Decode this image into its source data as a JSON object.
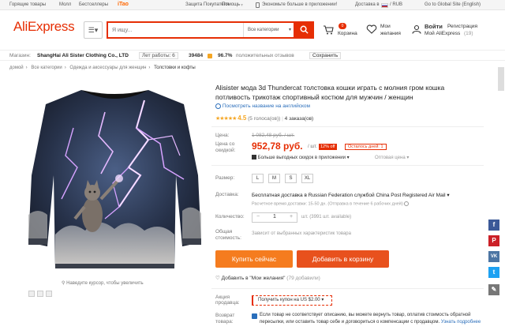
{
  "topbar": {
    "links": [
      "Горящие товары",
      "Молл",
      "Бестселлеры"
    ],
    "itao": "iTao",
    "buyer_protection": "Защита Покупателя",
    "help": "Помощь",
    "app_promo": "Экономьте больше в приложении!",
    "ship_to": "Доставка в",
    "currency": "/ RUB",
    "global_site": "Go to Global Site (English)"
  },
  "header": {
    "logo": "AliExpress",
    "search_placeholder": "Я ищу...",
    "search_category": "Все категории",
    "cart_count": "0",
    "cart_label": "Корзина",
    "wishlist_label_1": "Мои",
    "wishlist_label_2": "желания",
    "signin": "Войти",
    "register": "Регистрация",
    "my_ali": "Мой AliExpress",
    "my_ali_count": "(19)"
  },
  "store": {
    "label": "Магазин:",
    "name": "ShangHai Ali Sister Clothing Co., LTD",
    "years": "Лет работы: 6",
    "score": "39484",
    "positive": "96.7%",
    "positive_label": "положительных отзывов",
    "save": "Сохранить"
  },
  "breadcrumb": [
    "домой",
    "Все категории",
    "Одежда и аксессуары для женщин",
    "Толстовки и кофты"
  ],
  "product": {
    "title": "Alisister мода 3d Thundercat толстовка кошки играть с молния гром кошка потливость трикотаж спортивный костюм для мужчин / женщин",
    "translate": "Посмотреть название на английском",
    "rating": "4.5",
    "votes": "(5 голоса(ов))",
    "orders": "4 заказа(ов)",
    "price_label": "Цена:",
    "old_price": "1 082,48 руб. / шт.",
    "discount_label_1": "Цена со",
    "discount_label_2": "скидкой:",
    "price": "952,78 руб.",
    "per_unit": "/ шт.",
    "off": "12% off",
    "days_left": "Осталось дней: 1",
    "app_discount": "Больше выгодных скидок в приложении",
    "wholesale": "Оптовая цена",
    "size_label": "Размер:",
    "sizes": [
      "L",
      "M",
      "S",
      "XL"
    ],
    "shipping_label": "Доставка:",
    "shipping": "Бесплатная доставка в Russian Federation службой China Post Registered Air Mail",
    "shipping_sub": "Расчетное время доставки: 15-50 дн. (Отправка в течение 6 рабочих дней)",
    "qty_label": "Количество:",
    "qty_value": "1",
    "qty_note": "шт. (3991 шт. available)",
    "total_label_1": "Общая",
    "total_label_2": "стоимость:",
    "total_note": "Зависит от выбранных характеристик товара",
    "buy_now": "Купить сейчас",
    "add_to_cart": "Добавить в корзину",
    "wishlist": "Добавить в \"Мои желания\"",
    "wishlist_count": "(79 добавили)",
    "promo_label_1": "Акция",
    "promo_label_2": "продавца:",
    "coupon": "Получить купон на US $2.00",
    "return_label_1": "Возврат",
    "return_label_2": "товара:",
    "return_text": "Если товар не соответствует описанию, вы можете вернуть товар, оплатив стоимость обратной пересылки, или оставить товар себе и договориться о компенсации с продавцом.",
    "return_more": "Узнать подробнее",
    "zoom_hint": "Наведите курсор, чтобы увеличить"
  },
  "social": [
    "f",
    "P",
    "VK",
    "t"
  ],
  "colors": {
    "accent": "#e62e04",
    "buy_now": "#f57c1f",
    "add_cart": "#e8511d",
    "link": "#2a6ebb"
  }
}
